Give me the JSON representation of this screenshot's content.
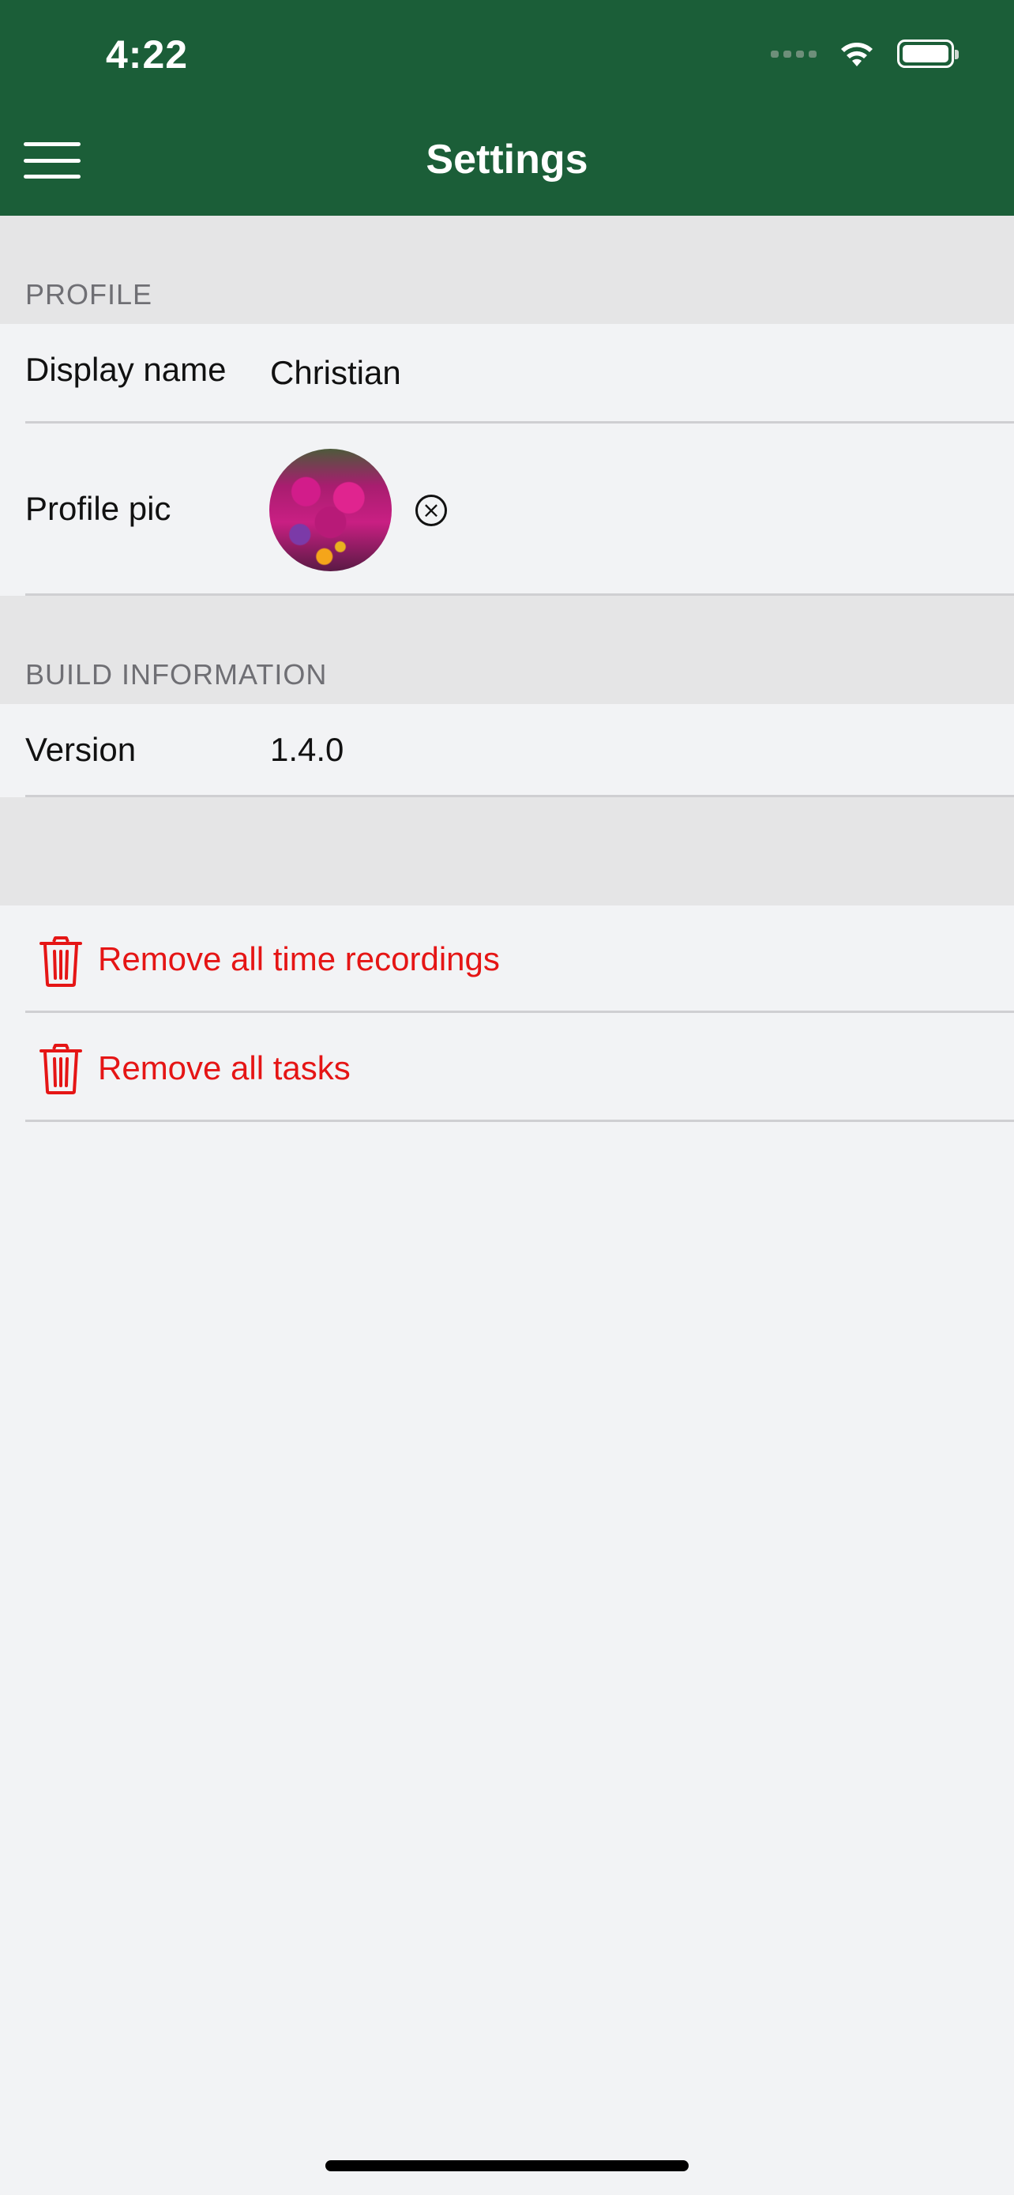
{
  "status_bar": {
    "time": "4:22"
  },
  "header": {
    "title": "Settings"
  },
  "profile_section": {
    "header": "PROFILE",
    "display_name_label": "Display name",
    "display_name_value": "Christian",
    "profile_pic_label": "Profile pic",
    "clear_symbol": "⨯"
  },
  "build_section": {
    "header": "BUILD INFORMATION",
    "version_label": "Version",
    "version_value": "1.4.0"
  },
  "actions": {
    "remove_time_recordings": "Remove all time recordings",
    "remove_tasks": "Remove all tasks"
  },
  "colors": {
    "header_bg": "#1b5e38",
    "danger": "#e51515",
    "background": "#f2f3f5",
    "section_bg": "#e5e5e6"
  }
}
